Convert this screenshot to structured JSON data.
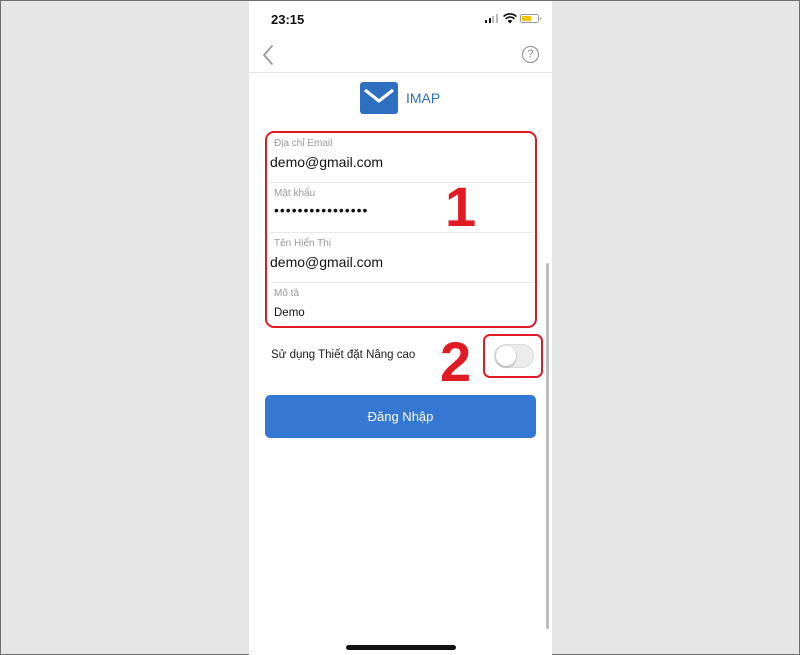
{
  "status_bar": {
    "time": "23:15"
  },
  "nav": {
    "help_symbol": "?"
  },
  "provider": {
    "name": "IMAP",
    "icon": "mail-icon",
    "icon_color": "#2e6fc0"
  },
  "form": {
    "fields": [
      {
        "label": "Địa chỉ Email",
        "value": "demo@gmail.com"
      },
      {
        "label": "Mật khẩu",
        "value": "••••••••••••••••"
      },
      {
        "label": "Tên Hiển Thị",
        "value": "demo@gmail.com"
      },
      {
        "label": "Mô tả",
        "value": "Demo"
      }
    ]
  },
  "annotations": {
    "step1": "1",
    "step2": "2",
    "color": "#e01b24"
  },
  "advanced": {
    "label": "Sử dụng Thiết đặt Nâng cao",
    "enabled": false
  },
  "login": {
    "label": "Đăng Nhập",
    "color": "#3478d4"
  }
}
